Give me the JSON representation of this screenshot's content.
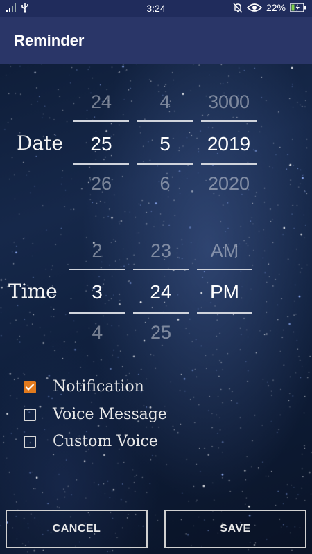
{
  "status_bar": {
    "time": "3:24",
    "battery": "22%",
    "icons": [
      "signal-icon",
      "usb-icon",
      "bell-off-icon",
      "eye-icon",
      "battery-charging-icon"
    ]
  },
  "app_bar": {
    "title": "Reminder"
  },
  "date_picker": {
    "label": "Date",
    "day": {
      "prev": "24",
      "selected": "25",
      "next": "26"
    },
    "month": {
      "prev": "4",
      "selected": "5",
      "next": "6"
    },
    "year": {
      "prev": "3000",
      "selected": "2019",
      "next": "2020"
    }
  },
  "time_picker": {
    "label": "Time",
    "hour": {
      "prev": "2",
      "selected": "3",
      "next": "4"
    },
    "minute": {
      "prev": "23",
      "selected": "24",
      "next": "25"
    },
    "ampm": {
      "prev": "AM",
      "selected": "PM",
      "next": ""
    }
  },
  "options": [
    {
      "label": "Notification",
      "checked": true
    },
    {
      "label": "Voice Message",
      "checked": false
    },
    {
      "label": "Custom Voice",
      "checked": false
    }
  ],
  "buttons": {
    "cancel": "CANCEL",
    "save": "SAVE"
  },
  "colors": {
    "status_bar": "#202c5c",
    "app_bar": "#2a3668",
    "checkbox_accent": "#e27a1d"
  }
}
